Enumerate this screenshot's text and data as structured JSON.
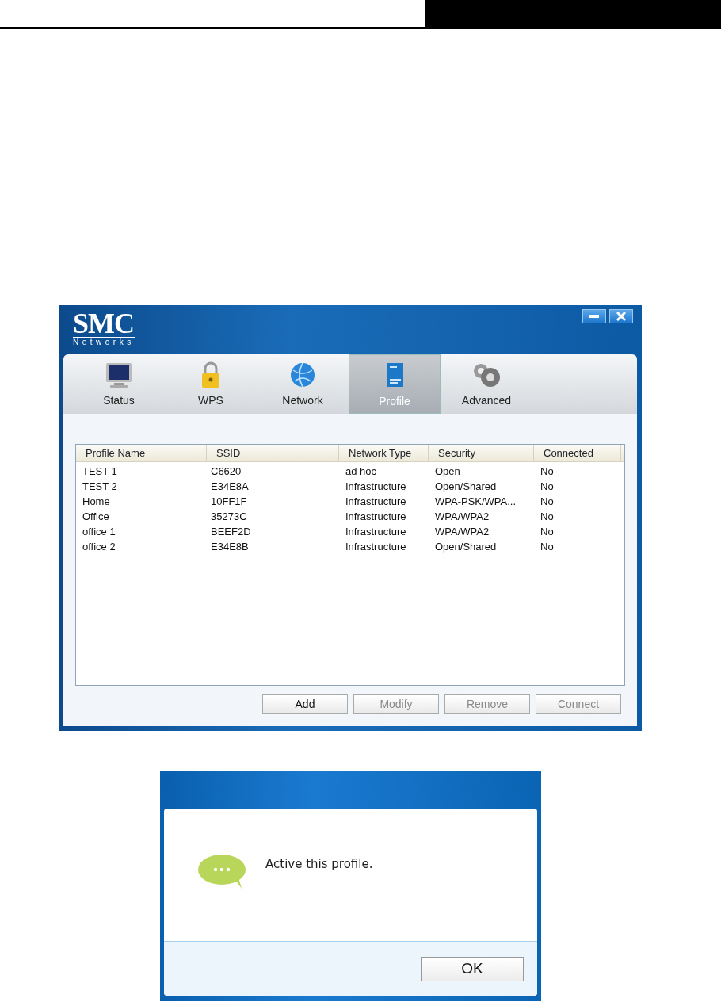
{
  "window": {
    "logo": "SMC",
    "logo_sub": "Networks"
  },
  "tabs": [
    {
      "label": "Status",
      "kind": "monitor",
      "selected": false
    },
    {
      "label": "WPS",
      "kind": "lock",
      "selected": false
    },
    {
      "label": "Network",
      "kind": "globe",
      "selected": false
    },
    {
      "label": "Profile",
      "kind": "document",
      "selected": true
    },
    {
      "label": "Advanced",
      "kind": "gears",
      "selected": false
    }
  ],
  "table": {
    "columns": [
      "Profile Name",
      "SSID",
      "Network Type",
      "Security",
      "Connected"
    ],
    "rows": [
      [
        "TEST 1",
        "C6620",
        "ad hoc",
        "Open",
        "No"
      ],
      [
        "TEST 2",
        "E34E8A",
        "Infrastructure",
        "Open/Shared",
        "No"
      ],
      [
        "Home",
        "10FF1F",
        "Infrastructure",
        "WPA-PSK/WPA...",
        "No"
      ],
      [
        "Office",
        "35273C",
        "Infrastructure",
        "WPA/WPA2",
        "No"
      ],
      [
        "office 1",
        "BEEF2D",
        "Infrastructure",
        "WPA/WPA2",
        "No"
      ],
      [
        "office 2",
        "E34E8B",
        "Infrastructure",
        "Open/Shared",
        "No"
      ]
    ]
  },
  "buttons": [
    {
      "label": "Add",
      "disabled": false
    },
    {
      "label": "Modify",
      "disabled": true
    },
    {
      "label": "Remove",
      "disabled": true
    },
    {
      "label": "Connect",
      "disabled": true
    }
  ],
  "dialog": {
    "message": "Active this profile.",
    "button": "OK"
  }
}
